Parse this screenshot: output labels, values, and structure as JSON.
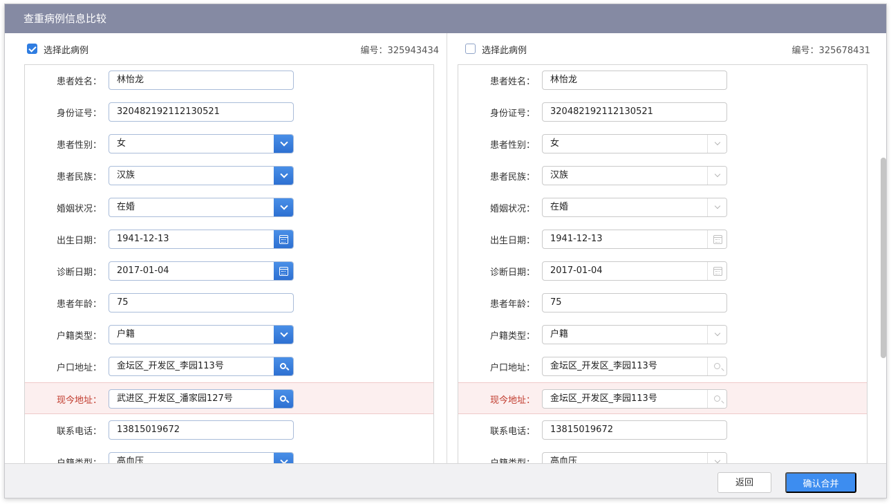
{
  "dialog": {
    "title": "查重病例信息比较"
  },
  "panels": [
    {
      "select_label": "选择此病例",
      "selected": true,
      "record_no": "编号：325943434",
      "fields": [
        {
          "label": "患者姓名：",
          "value": "林怡龙",
          "control": "text"
        },
        {
          "label": "身份证号：",
          "value": "320482192112130521",
          "control": "text"
        },
        {
          "label": "患者性别：",
          "value": "女",
          "control": "select"
        },
        {
          "label": "患者民族：",
          "value": "汉族",
          "control": "select"
        },
        {
          "label": "婚姻状况：",
          "value": "在婚",
          "control": "select"
        },
        {
          "label": "出生日期：",
          "value": "1941-12-13",
          "control": "date"
        },
        {
          "label": "诊断日期：",
          "value": "2017-01-04",
          "control": "date"
        },
        {
          "label": "患者年龄：",
          "value": "75",
          "control": "text"
        },
        {
          "label": "户籍类型：",
          "value": "户籍",
          "control": "select"
        },
        {
          "label": "户口地址：",
          "value": "金坛区_开发区_李园113号",
          "control": "search"
        },
        {
          "label": "现今地址：",
          "value": "武进区_开发区_潘家园127号",
          "control": "search",
          "highlight": true
        },
        {
          "label": "联系电话：",
          "value": "13815019672",
          "control": "text"
        },
        {
          "label": "户籍类型：",
          "value": "高血压",
          "control": "select"
        }
      ]
    },
    {
      "select_label": "选择此病例",
      "selected": false,
      "record_no": "编号：325678431",
      "fields": [
        {
          "label": "患者姓名：",
          "value": "林怡龙",
          "control": "text"
        },
        {
          "label": "身份证号：",
          "value": "320482192112130521",
          "control": "text"
        },
        {
          "label": "患者性别：",
          "value": "女",
          "control": "select"
        },
        {
          "label": "患者民族：",
          "value": "汉族",
          "control": "select"
        },
        {
          "label": "婚姻状况：",
          "value": "在婚",
          "control": "select"
        },
        {
          "label": "出生日期：",
          "value": "1941-12-13",
          "control": "date"
        },
        {
          "label": "诊断日期：",
          "value": "2017-01-04",
          "control": "date"
        },
        {
          "label": "患者年龄：",
          "value": "75",
          "control": "text"
        },
        {
          "label": "户籍类型：",
          "value": "户籍",
          "control": "select"
        },
        {
          "label": "户口地址：",
          "value": "金坛区_开发区_李园113号",
          "control": "search"
        },
        {
          "label": "现今地址：",
          "value": "金坛区_开发区_李园113号",
          "control": "search",
          "highlight": true
        },
        {
          "label": "联系电话：",
          "value": "13815019672",
          "control": "text"
        },
        {
          "label": "户籍类型：",
          "value": "高血压",
          "control": "select"
        }
      ]
    }
  ],
  "footer": {
    "back_label": "返回",
    "merge_label": "确认合并"
  },
  "colors": {
    "titlebar": "#858aa3",
    "primary": "#3d8df0",
    "highlight_row": "#fcefef",
    "highlight_label": "#c0392b"
  }
}
